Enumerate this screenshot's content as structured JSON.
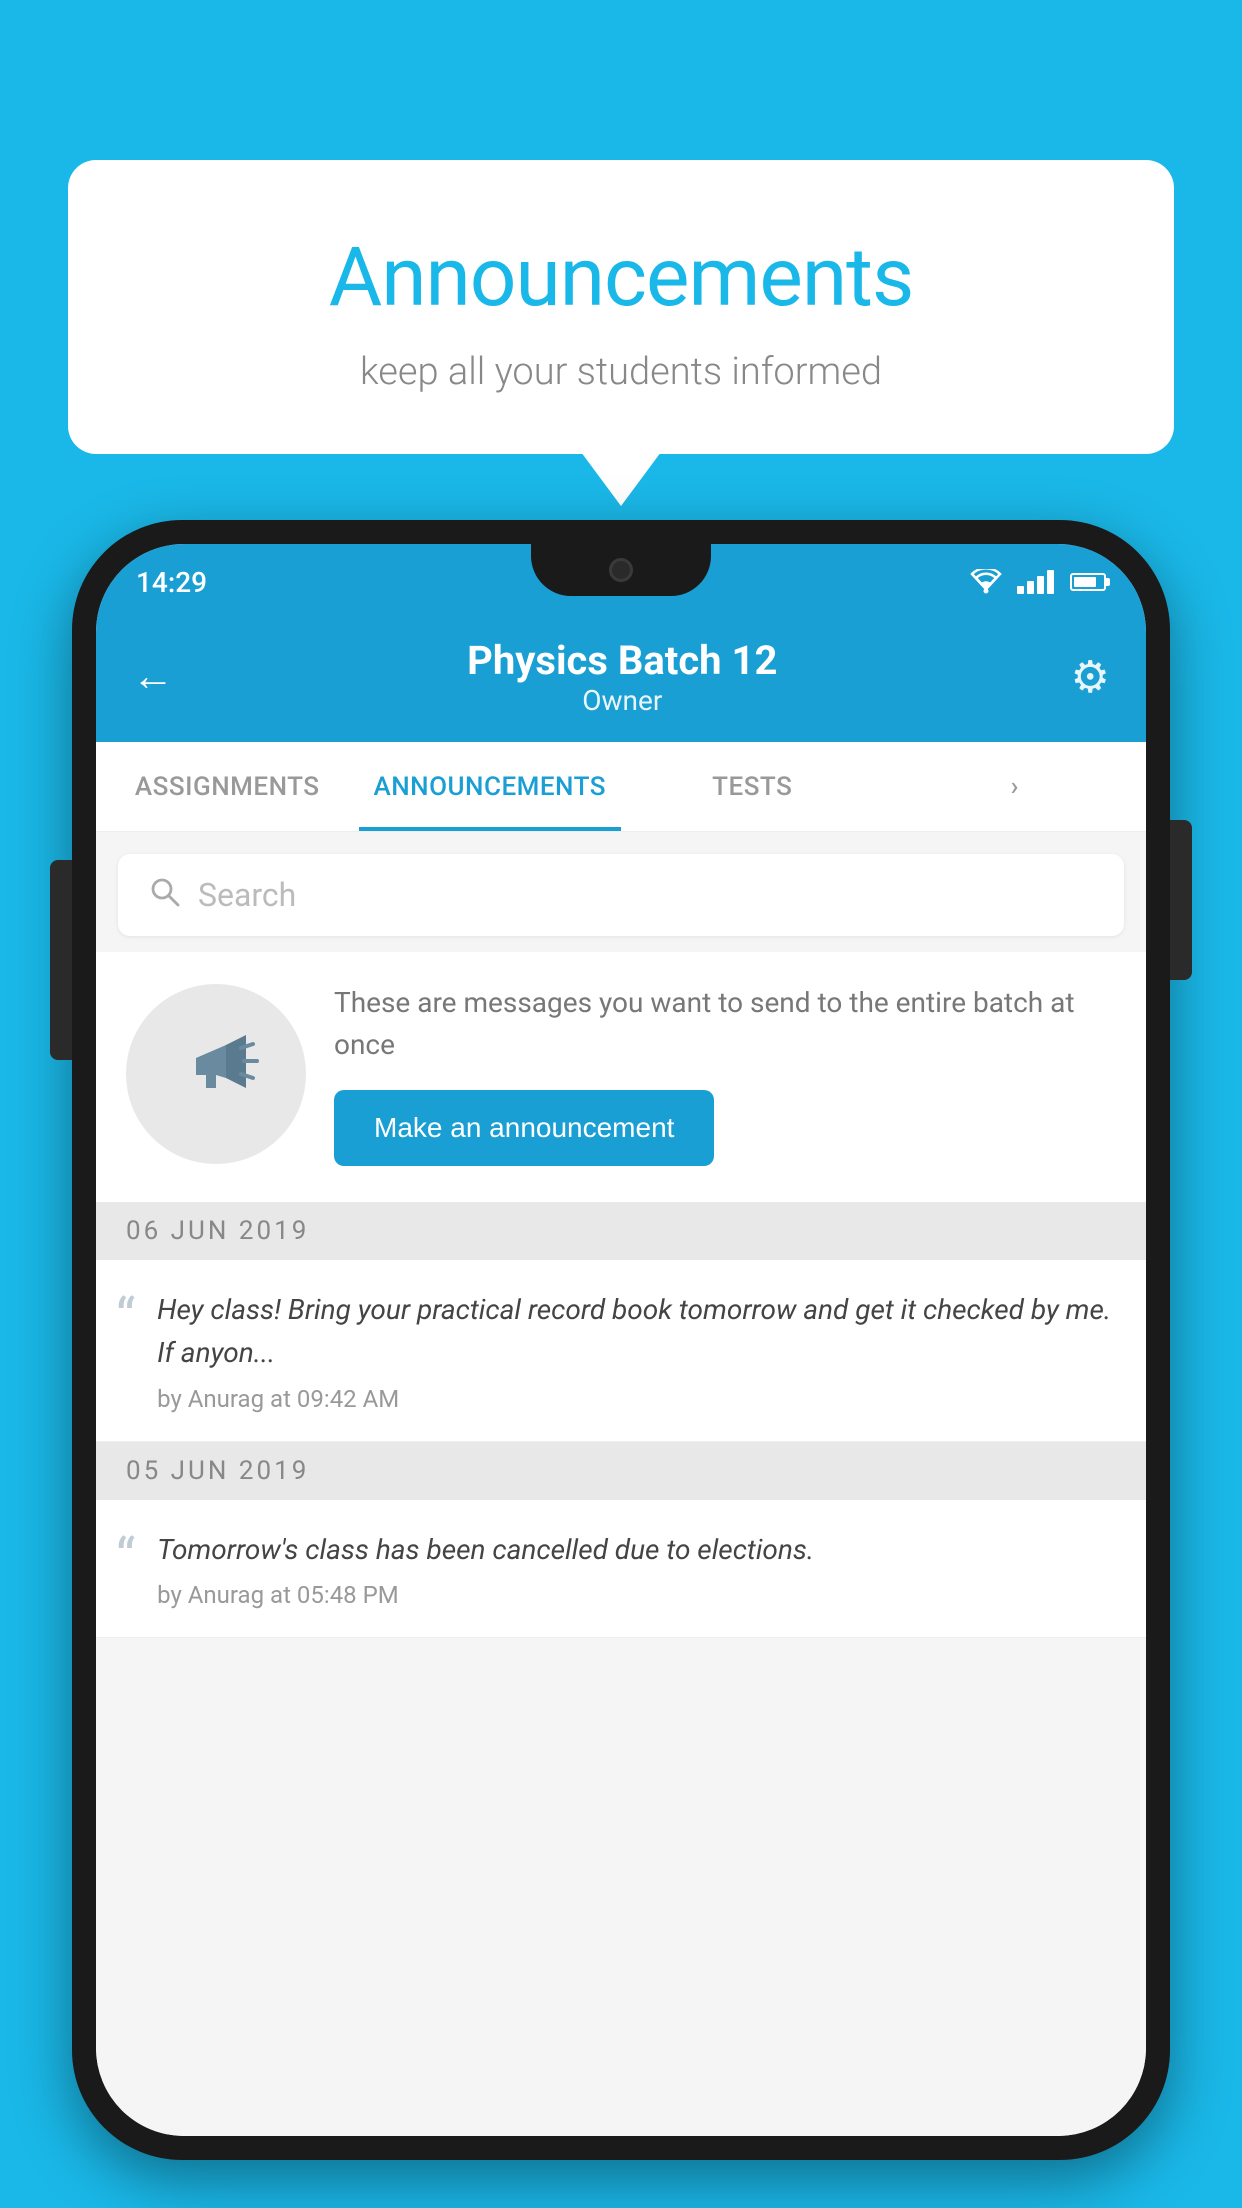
{
  "background_color": "#1ab8e8",
  "speech_bubble": {
    "title": "Announcements",
    "subtitle": "keep all your students informed"
  },
  "phone": {
    "status_bar": {
      "time": "14:29"
    },
    "header": {
      "title": "Physics Batch 12",
      "subtitle": "Owner",
      "back_label": "Back",
      "settings_label": "Settings"
    },
    "tabs": [
      {
        "label": "ASSIGNMENTS",
        "active": false
      },
      {
        "label": "ANNOUNCEMENTS",
        "active": true
      },
      {
        "label": "TESTS",
        "active": false
      },
      {
        "label": "...",
        "active": false
      }
    ],
    "search": {
      "placeholder": "Search"
    },
    "promo": {
      "description": "These are messages you want to send to the entire batch at once",
      "button_label": "Make an announcement"
    },
    "announcements": [
      {
        "date": "06  JUN  2019",
        "items": [
          {
            "message": "Hey class! Bring your practical record book tomorrow and get it checked by me. If anyon...",
            "meta": "by Anurag at 09:42 AM"
          }
        ]
      },
      {
        "date": "05  JUN  2019",
        "items": [
          {
            "message": "Tomorrow's class has been cancelled due to elections.",
            "meta": "by Anurag at 05:48 PM"
          }
        ]
      }
    ]
  }
}
